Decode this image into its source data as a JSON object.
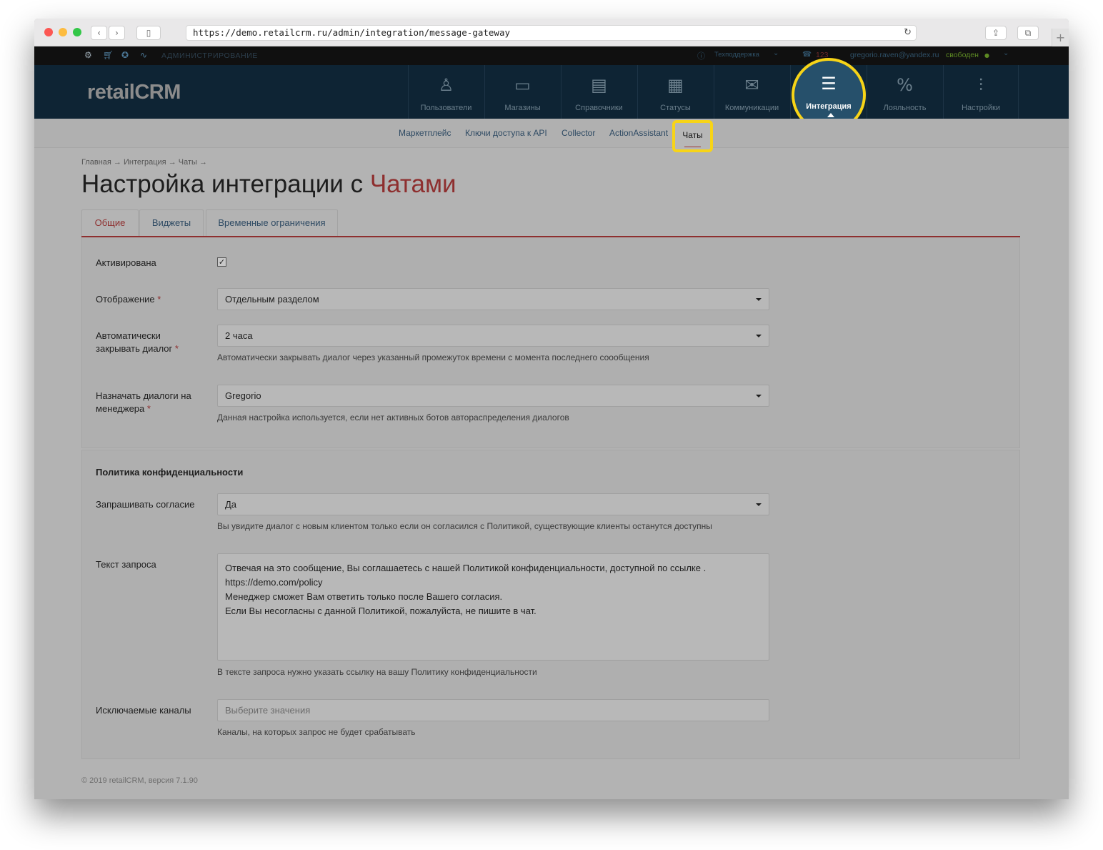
{
  "browser": {
    "url": "https://demo.retailcrm.ru/admin/integration/message-gateway"
  },
  "adminbar": {
    "label": "АДМИНИСТРИРОВАНИЕ",
    "support": "Техподдержка",
    "calls_count": "123",
    "user_email": "gregorio.raven@yandex.ru",
    "user_status": "свободен"
  },
  "logo": "retailCRM",
  "nav": {
    "items": [
      {
        "label": "Пользователи",
        "icon": "user-icon"
      },
      {
        "label": "Магазины",
        "icon": "store-icon"
      },
      {
        "label": "Справочники",
        "icon": "reference-icon"
      },
      {
        "label": "Статусы",
        "icon": "statuses-icon"
      },
      {
        "label": "Коммуникации",
        "icon": "communications-icon"
      },
      {
        "label": "Интеграция",
        "icon": "integration-icon"
      },
      {
        "label": "Лояльность",
        "icon": "loyalty-icon"
      },
      {
        "label": "Настройки",
        "icon": "settings-sliders-icon"
      }
    ],
    "active": "Интеграция"
  },
  "subnav": {
    "items": [
      "Маркетплейс",
      "Ключи доступа к API",
      "Collector",
      "ActionAssistant",
      "Чаты"
    ],
    "active": "Чаты"
  },
  "breadcrumb": "Главная → Интеграция → Чаты →",
  "title": {
    "prefix": "Настройка интеграции с ",
    "accent": "Чатами"
  },
  "tabs": [
    "Общие",
    "Виджеты",
    "Временные ограничения"
  ],
  "general": {
    "activated_label": "Активирована",
    "activated_checked": true,
    "display_label": "Отображение",
    "display_value": "Отдельным разделом",
    "autoclose_label_1": "Автоматически",
    "autoclose_label_2": "закрывать диалог",
    "autoclose_value": "2 часа",
    "autoclose_hint": "Автоматически закрывать диалог через указанный промежуток времени с момента последнего соообщения",
    "assign_label_1": "Назначать диалоги на",
    "assign_label_2": "менеджера",
    "assign_value": "Gregorio",
    "assign_hint": "Данная настройка используется, если нет активных ботов автораспределения диалогов"
  },
  "privacy": {
    "title": "Политика конфиденциальности",
    "consent_label": "Запрашивать согласие",
    "consent_value": "Да",
    "consent_hint": "Вы увидите диалог с новым клиентом только если он согласился с Политикой, существующие клиенты останутся доступны",
    "request_label": "Текст запроса",
    "request_lines": [
      "Отвечая на это сообщение, Вы соглашаетесь с нашей Политикой конфиденциальности, доступной по ссылке .",
      "https://demo.com/policy",
      "Менеджер сможет Вам ответить только после Вашего согласия.",
      "Если Вы несогласны с данной Политикой, пожалуйста, не пишите в чат."
    ],
    "request_hint": "В тексте запроса нужно указать ссылку на вашу Политику конфиденциальности",
    "excluded_label": "Исключаемые каналы",
    "excluded_placeholder": "Выберите значения",
    "excluded_hint": "Каналы, на которых запрос не будет срабатывать"
  },
  "footer": "© 2019 retailCRM, версия 7.1.90",
  "colors": {
    "accent": "#8e2f2f",
    "nav_bg": "#0e2434",
    "highlight": "#f7d417"
  }
}
